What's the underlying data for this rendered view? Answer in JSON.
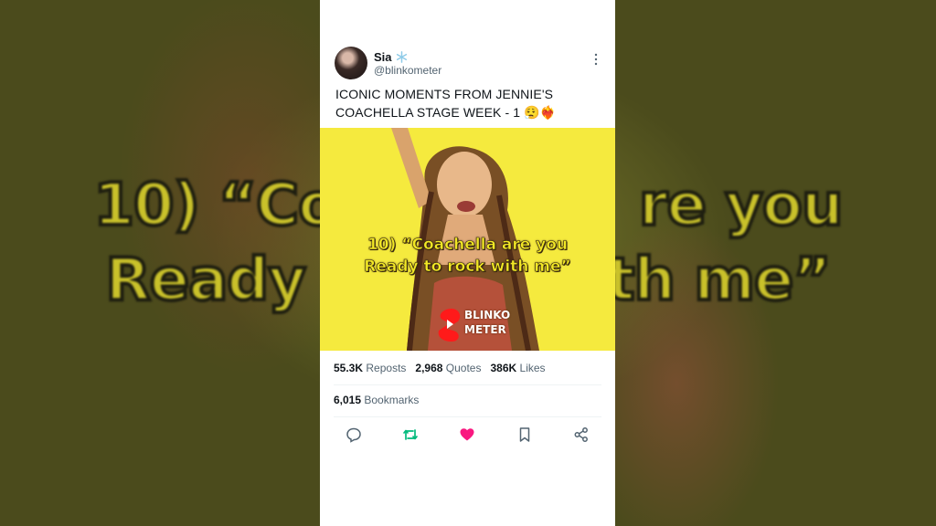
{
  "backdrop": {
    "caption_line1": "10) “Co",
    "caption_line1b": "re you",
    "caption_line2": "Ready",
    "caption_line2b": "th me”"
  },
  "tweet": {
    "display_name": "Sia",
    "verified_badge": "snowflake-badge",
    "handle": "@blinkometer",
    "text": "ICONIC MOMENTS FROM JENNIE'S COACHELLA STAGE WEEK - 1 😮‍💨❤️‍🔥",
    "media": {
      "caption_line1": "10) “Coachella are you",
      "caption_line2": "Ready to rock with me”",
      "watermark_line1": "BLINKO",
      "watermark_line2": "METER",
      "background_color": "#f5ea3e"
    },
    "stats": {
      "reposts_count": "55.3K",
      "reposts_label": "Reposts",
      "quotes_count": "2,968",
      "quotes_label": "Quotes",
      "likes_count": "386K",
      "likes_label": "Likes",
      "bookmarks_count": "6,015",
      "bookmarks_label": "Bookmarks"
    },
    "actions": [
      "reply-icon",
      "retweet-icon",
      "like-icon",
      "bookmark-icon",
      "share-icon"
    ],
    "colors": {
      "retweet": "#00ba7c",
      "like": "#f91880",
      "icon": "#536471"
    }
  }
}
